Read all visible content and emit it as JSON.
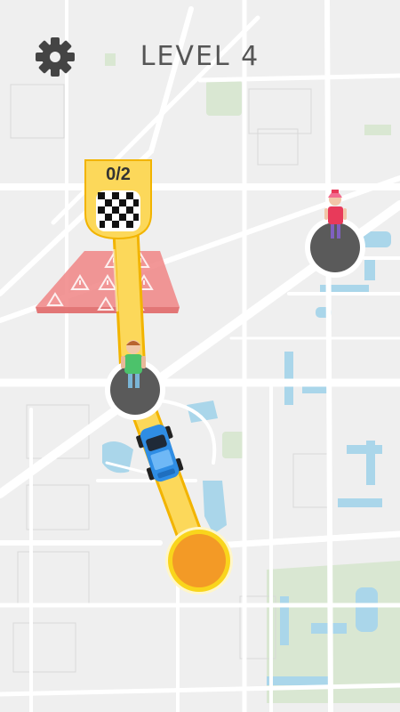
{
  "hud": {
    "level_label": "LEVEL 4"
  },
  "finish_flag": {
    "progress_label": "0/2"
  },
  "colors": {
    "background": "#eeeeee",
    "road": "#ffffff",
    "water": "#a9d7ea",
    "park": "#d6e6cf",
    "route": "#fcd85a",
    "route_edge": "#f2b400",
    "danger_zone": "#f08080",
    "start_marker": "#f39c26",
    "pickup_platform": "#555555",
    "car_body": "#2f8de4"
  },
  "icons": {
    "settings": "gear-icon",
    "finish": "checkered-flag-icon",
    "warning": "warning-icon"
  }
}
